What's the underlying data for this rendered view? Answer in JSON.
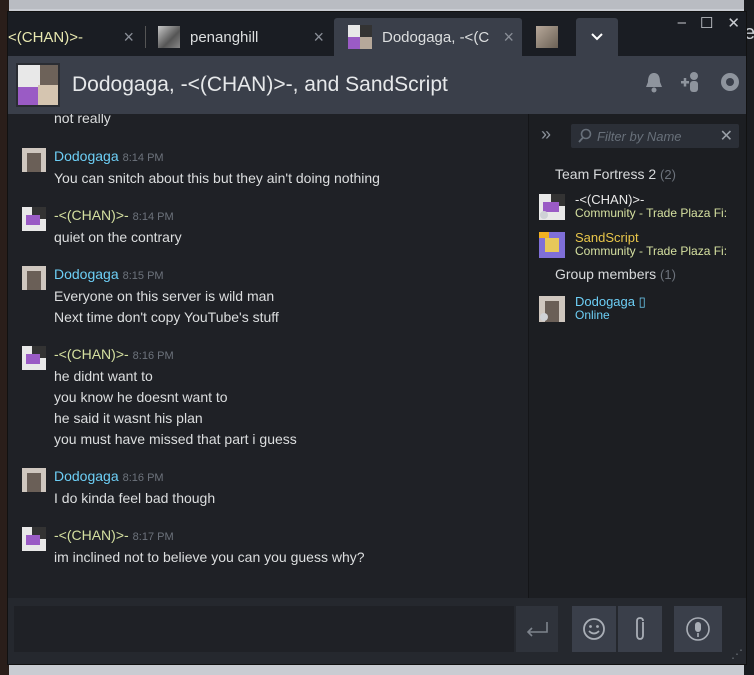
{
  "tabs": [
    {
      "label": "<(CHAN)>-"
    },
    {
      "label": "penanghill"
    },
    {
      "label": "Dodogaga, -<(C"
    },
    {
      "label": ""
    }
  ],
  "header": {
    "title": "Dodogaga, -<(CHAN)>-, and SandScript"
  },
  "messages": [
    {
      "name": "",
      "time": "",
      "lines": [
        "not really"
      ]
    },
    {
      "name": "Dodogaga",
      "time": "8:14 PM",
      "lines": [
        "You can snitch about this but they ain't doing nothing"
      ],
      "color": "#6dcff6"
    },
    {
      "name": "-<(CHAN)>-",
      "time": "8:14 PM",
      "lines": [
        "quiet on the contrary"
      ],
      "color": "#d5e0a0"
    },
    {
      "name": "Dodogaga",
      "time": "8:15 PM",
      "lines": [
        "Everyone on this server is wild man",
        "Next time don't copy YouTube's stuff"
      ],
      "color": "#6dcff6"
    },
    {
      "name": "-<(CHAN)>-",
      "time": "8:16 PM",
      "lines": [
        "he didnt want to",
        "you know he doesnt want to",
        "he said it wasnt his plan",
        "you must have missed that part i guess"
      ],
      "color": "#d5e0a0"
    },
    {
      "name": "Dodogaga",
      "time": "8:16 PM",
      "lines": [
        "I do kinda feel bad though"
      ],
      "color": "#6dcff6"
    },
    {
      "name": "-<(CHAN)>-",
      "time": "8:17 PM",
      "lines": [
        "im inclined not to believe you can you guess why?"
      ],
      "color": "#d5e0a0"
    }
  ],
  "members": {
    "filter_placeholder": "Filter by Name",
    "sections": [
      {
        "title": "Team Fortress 2",
        "count": "(2)"
      },
      {
        "title": "Group members",
        "count": "(1)"
      }
    ],
    "people": [
      {
        "name": "-<(CHAN)>-",
        "status": "Community - Trade Plaza Fi:"
      },
      {
        "name": "SandScript",
        "status": "Community - Trade Plaza Fi:"
      },
      {
        "name": "Dodogaga",
        "status": "Online"
      }
    ]
  },
  "icons": {
    "close": "×",
    "chevron": "⌄",
    "bell": "🔔",
    "add-friend": "👤+",
    "gear": "⚙",
    "collapse": "»",
    "search": "⚲",
    "send": "⏎",
    "emoji": "☺",
    "attach": "📎",
    "mic": "🎙"
  },
  "colors": {
    "friend_in_game": "#d5e0a0",
    "friend_online": "#6dcff6",
    "accent_bg": "#3a3f4a"
  }
}
